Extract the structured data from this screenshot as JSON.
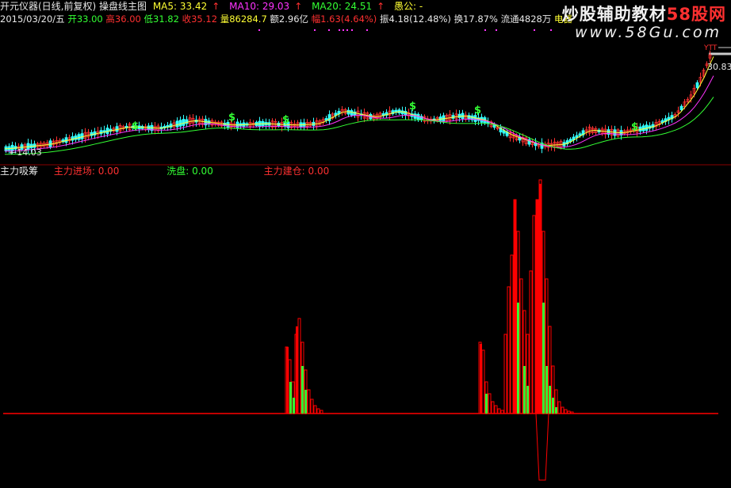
{
  "header": {
    "title": "开元仪器(日线,前复权) 操盘线主图",
    "ma5_label": "MA5: 33.42",
    "ma10_label": "MA10: 29.03",
    "ma20_label": "MA20: 24.51",
    "field_label": "愚公: -",
    "arrow": "↑"
  },
  "quote": {
    "date": "2015/03/20/五",
    "open": "开33.00",
    "high": "高36.00",
    "low": "低31.82",
    "close": "收35.12",
    "volume": "量86284.7",
    "amount": "额2.96亿",
    "change": "幅1.63(4.64%)",
    "amplitude": "振4.18(12.48%)",
    "turnover": "换17.87%",
    "float": "流通4828万",
    "sector": "电器"
  },
  "chart_labels": {
    "low_price": "←14.03",
    "high_price": "30.83",
    "signal_mark": "$",
    "top_marker": "YTT"
  },
  "indicator": {
    "name": "主力吸筹",
    "main_force_in": "主力进场: 0.00",
    "wash": "洗盘: 0.00",
    "main_force_build": "主力建仓: 0.00"
  },
  "watermark": {
    "line1_a": "炒股辅助教材",
    "line1_b": "58股网",
    "line2": "www.58Gu.com"
  },
  "colors": {
    "background": "#000000",
    "up_candle": "#ff3030",
    "down_candle": "#33ffff",
    "ma5": "#ffff33",
    "ma10": "#ff33ff",
    "ma20": "#33ff33",
    "indicator_red": "#ff0000",
    "indicator_green": "#33ff33"
  },
  "chart_data": {
    "type": "bar",
    "title": "主力吸筹",
    "series": [
      {
        "name": "主力进场",
        "values": [
          0,
          0,
          0,
          0,
          0,
          0,
          0,
          0,
          0,
          0,
          0,
          0,
          0,
          0,
          0,
          0,
          0,
          0,
          0,
          0,
          0,
          0,
          0,
          0,
          0,
          0,
          0,
          0,
          0,
          0,
          0,
          0,
          0,
          0,
          0,
          0,
          0,
          0,
          0,
          0,
          0,
          0,
          0,
          0,
          0,
          0,
          0,
          0,
          0,
          0,
          0,
          0,
          0,
          0,
          0,
          0,
          0,
          0,
          0,
          0,
          0,
          0,
          0,
          0,
          0,
          0,
          0,
          0,
          0,
          0,
          0,
          0,
          0,
          0,
          0,
          0,
          0,
          0,
          0,
          0,
          0,
          0,
          0,
          0,
          0,
          0,
          0,
          0,
          0,
          0,
          0,
          0,
          0,
          0,
          0,
          0,
          0,
          0,
          0,
          0,
          0,
          0,
          0,
          0,
          0,
          0,
          0,
          0,
          0,
          0,
          0,
          0,
          0,
          0,
          0,
          0,
          0,
          0,
          0,
          0,
          0,
          0,
          0,
          0,
          0,
          0,
          0,
          0,
          0,
          0,
          0,
          0,
          0,
          0,
          0,
          0,
          0,
          0,
          0,
          0,
          0,
          0,
          0,
          0,
          0,
          0,
          0,
          0,
          0,
          0,
          0,
          0,
          0,
          0,
          0,
          0,
          0,
          0,
          0,
          0,
          0,
          0,
          0,
          0,
          0,
          0,
          0,
          0,
          0,
          0,
          0,
          0,
          0,
          0,
          0,
          0,
          0,
          0,
          0,
          0,
          0,
          0,
          0,
          0,
          0,
          0,
          0,
          0,
          0,
          0,
          0,
          0,
          0,
          0,
          0,
          0,
          0,
          0,
          0,
          0,
          0,
          0,
          0,
          0,
          0,
          0,
          0,
          0,
          0,
          0,
          0,
          0,
          0,
          0,
          0,
          0,
          0,
          0,
          0,
          0,
          0,
          0,
          0,
          0,
          0,
          0,
          0,
          0,
          0
        ]
      },
      {
        "name": "洗盘",
        "values": [
          0
        ]
      },
      {
        "name": "主力建仓",
        "values": [
          0
        ]
      }
    ],
    "ylim": [
      -0.3,
      1.0
    ]
  }
}
